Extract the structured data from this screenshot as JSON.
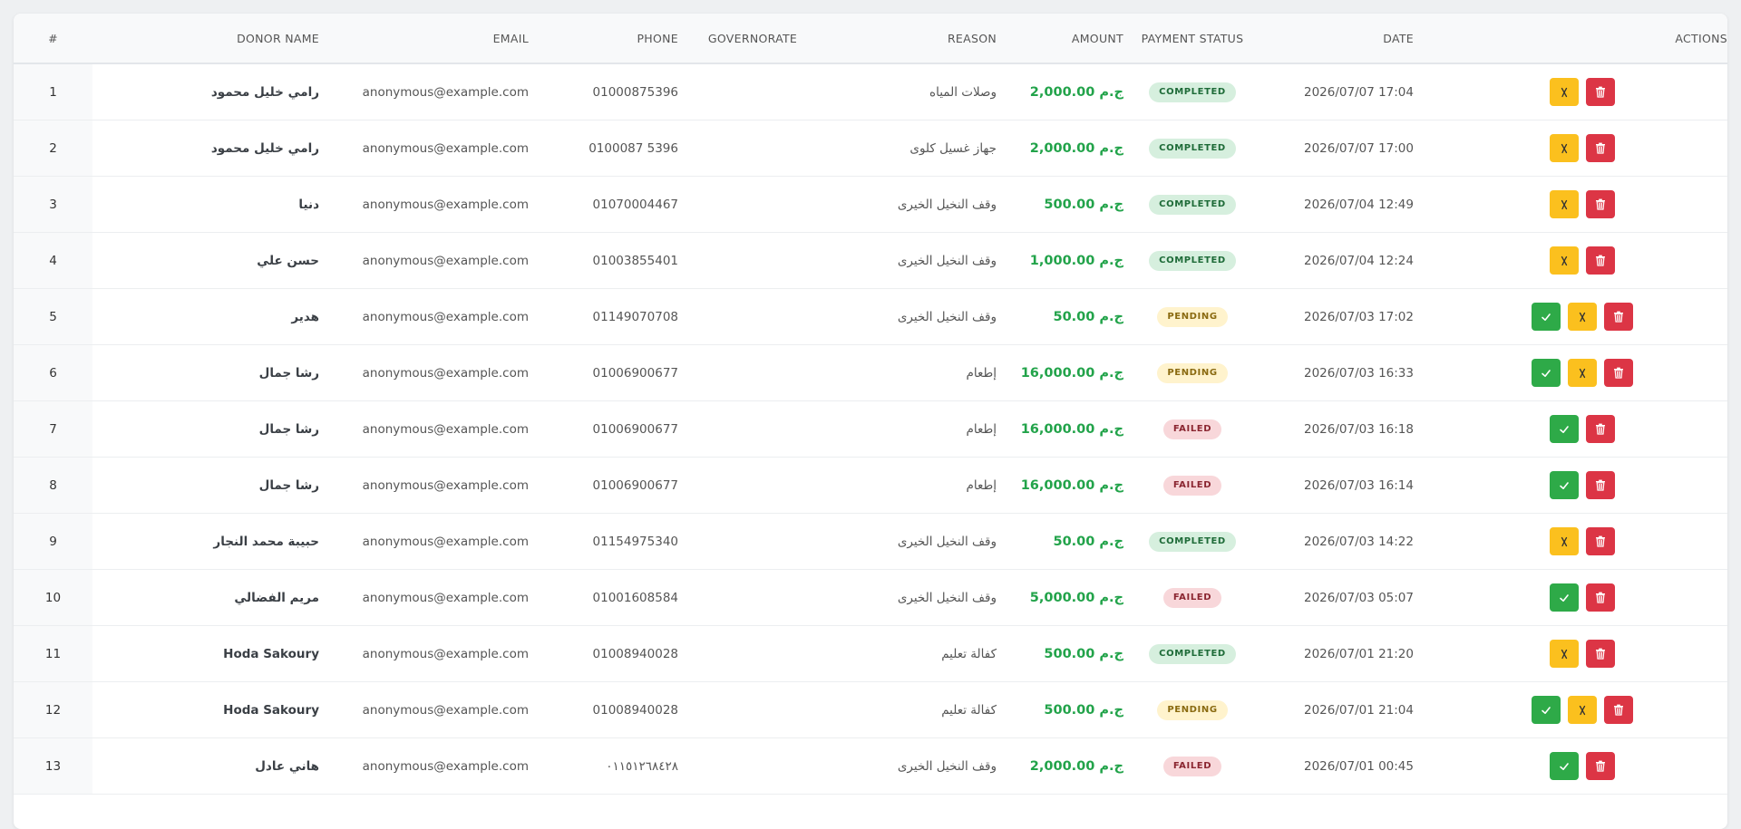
{
  "table": {
    "headers": {
      "index": "#",
      "donor_name": "DONOR NAME",
      "email": "EMAIL",
      "phone": "PHONE",
      "governorate": "GOVERNORATE",
      "reason": "REASON",
      "amount": "AMOUNT",
      "payment_status": "PAYMENT STATUS",
      "date": "DATE",
      "actions": "ACTIONS"
    },
    "rows": [
      {
        "index": "1",
        "donor_name": "رامي خليل محمود",
        "email": "anonymous@example.com",
        "phone": "01000875396",
        "governorate": "",
        "reason": "وصلات المياه",
        "amount": "ج.م 2,000.00",
        "status": "COMPLETED",
        "date": "2026/07/07 17:04",
        "actions": [
          "reject",
          "delete"
        ]
      },
      {
        "index": "2",
        "donor_name": "رامي خليل محمود",
        "email": "anonymous@example.com",
        "phone": "0100087 5396",
        "governorate": "",
        "reason": "جهاز غسيل كلوى",
        "amount": "ج.م 2,000.00",
        "status": "COMPLETED",
        "date": "2026/07/07 17:00",
        "actions": [
          "reject",
          "delete"
        ]
      },
      {
        "index": "3",
        "donor_name": "دنيا",
        "email": "anonymous@example.com",
        "phone": "01070004467",
        "governorate": "",
        "reason": "وقف النخيل الخيرى",
        "amount": "ج.م 500.00",
        "status": "COMPLETED",
        "date": "2026/07/04 12:49",
        "actions": [
          "reject",
          "delete"
        ]
      },
      {
        "index": "4",
        "donor_name": "حسن علي",
        "email": "anonymous@example.com",
        "phone": "01003855401",
        "governorate": "",
        "reason": "وقف النخيل الخيرى",
        "amount": "ج.م 1,000.00",
        "status": "COMPLETED",
        "date": "2026/07/04 12:24",
        "actions": [
          "reject",
          "delete"
        ]
      },
      {
        "index": "5",
        "donor_name": "هدير",
        "email": "anonymous@example.com",
        "phone": "01149070708",
        "governorate": "",
        "reason": "وقف النخيل الخيرى",
        "amount": "ج.م 50.00",
        "status": "PENDING",
        "date": "2026/07/03 17:02",
        "actions": [
          "approve",
          "reject",
          "delete"
        ]
      },
      {
        "index": "6",
        "donor_name": "رشا جمال",
        "email": "anonymous@example.com",
        "phone": "01006900677",
        "governorate": "",
        "reason": "إطعام",
        "amount": "ج.م 16,000.00",
        "status": "PENDING",
        "date": "2026/07/03 16:33",
        "actions": [
          "approve",
          "reject",
          "delete"
        ]
      },
      {
        "index": "7",
        "donor_name": "رشا جمال",
        "email": "anonymous@example.com",
        "phone": "01006900677",
        "governorate": "",
        "reason": "إطعام",
        "amount": "ج.م 16,000.00",
        "status": "FAILED",
        "date": "2026/07/03 16:18",
        "actions": [
          "approve",
          "delete"
        ]
      },
      {
        "index": "8",
        "donor_name": "رشا جمال",
        "email": "anonymous@example.com",
        "phone": "01006900677",
        "governorate": "",
        "reason": "إطعام",
        "amount": "ج.م 16,000.00",
        "status": "FAILED",
        "date": "2026/07/03 16:14",
        "actions": [
          "approve",
          "delete"
        ]
      },
      {
        "index": "9",
        "donor_name": "حبيبة محمد النجار",
        "email": "anonymous@example.com",
        "phone": "01154975340",
        "governorate": "",
        "reason": "وقف النخيل الخيرى",
        "amount": "ج.م 50.00",
        "status": "COMPLETED",
        "date": "2026/07/03 14:22",
        "actions": [
          "reject",
          "delete"
        ]
      },
      {
        "index": "10",
        "donor_name": "مريم الفضالي",
        "email": "anonymous@example.com",
        "phone": "01001608584",
        "governorate": "",
        "reason": "وقف النخيل الخيرى",
        "amount": "ج.م 5,000.00",
        "status": "FAILED",
        "date": "2026/07/03 05:07",
        "actions": [
          "approve",
          "delete"
        ]
      },
      {
        "index": "11",
        "donor_name": "Hoda Sakoury",
        "email": "anonymous@example.com",
        "phone": "01008940028",
        "governorate": "",
        "reason": "كفالة تعليم",
        "amount": "ج.م 500.00",
        "status": "COMPLETED",
        "date": "2026/07/01 21:20",
        "actions": [
          "reject",
          "delete"
        ]
      },
      {
        "index": "12",
        "donor_name": "Hoda Sakoury",
        "email": "anonymous@example.com",
        "phone": "01008940028",
        "governorate": "",
        "reason": "كفالة تعليم",
        "amount": "ج.م 500.00",
        "status": "PENDING",
        "date": "2026/07/01 21:04",
        "actions": [
          "approve",
          "reject",
          "delete"
        ]
      },
      {
        "index": "13",
        "donor_name": "هاني عادل",
        "email": "anonymous@example.com",
        "phone": "٠١١٥١٢٦٨٤٢٨",
        "governorate": "",
        "reason": "وقف النخيل الخيرى",
        "amount": "ج.م 2,000.00",
        "status": "FAILED",
        "date": "2026/07/01 00:45",
        "actions": [
          "approve",
          "delete"
        ]
      }
    ]
  },
  "action_icons": {
    "approve": "check-icon",
    "reject": "x-icon",
    "delete": "trash-icon"
  },
  "colors": {
    "amount": "#22a34a",
    "approve": "#2eaa48",
    "reject": "#fbc01e",
    "delete": "#dc3545",
    "completed_bg": "#d6efde",
    "pending_bg": "#fff3cd",
    "failed_bg": "#f8d7da"
  }
}
